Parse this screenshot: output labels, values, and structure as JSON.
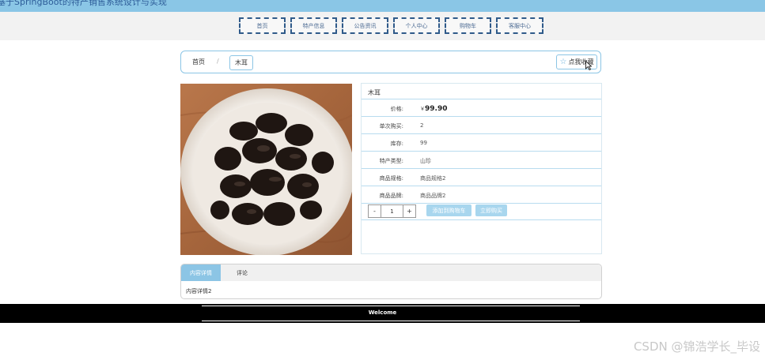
{
  "header": {
    "title": "基于SpringBoot的特产销售系统设计与实现"
  },
  "nav": [
    {
      "label": "首页"
    },
    {
      "label": "特产信息"
    },
    {
      "label": "公告资讯"
    },
    {
      "label": "个人中心"
    },
    {
      "label": "购物车"
    },
    {
      "label": "客服中心"
    }
  ],
  "breadcrumb": {
    "home": "首页",
    "sep": "/",
    "current": "木耳"
  },
  "favorite": {
    "label": "点我收藏",
    "icon": "star-icon"
  },
  "product": {
    "image_alt": "木耳",
    "name": "木耳",
    "price_label": "价格:",
    "price_currency": "￥",
    "price": "99.90",
    "rows": [
      {
        "label": "单次购买:",
        "value": "2"
      },
      {
        "label": "库存:",
        "value": "99"
      },
      {
        "label": "特产类型:",
        "value": "山珍"
      },
      {
        "label": "商品规格:",
        "value": "商品规格2"
      },
      {
        "label": "商品品牌:",
        "value": "商品品牌2"
      }
    ],
    "qty": {
      "minus": "-",
      "value": "1",
      "plus": "+"
    },
    "add_to_cart": "添加到购物车",
    "buy_now": "立即购买"
  },
  "tabs": {
    "items": [
      "内容详情",
      "评论"
    ],
    "active": 0,
    "content": "内容详情2"
  },
  "footer": {
    "text": "Welcome"
  },
  "watermark": "CSDN @锦浩学长_毕设",
  "colors": {
    "accent": "#8cc5e5",
    "topbar": "#8ac6e6",
    "footer": "#000000"
  }
}
